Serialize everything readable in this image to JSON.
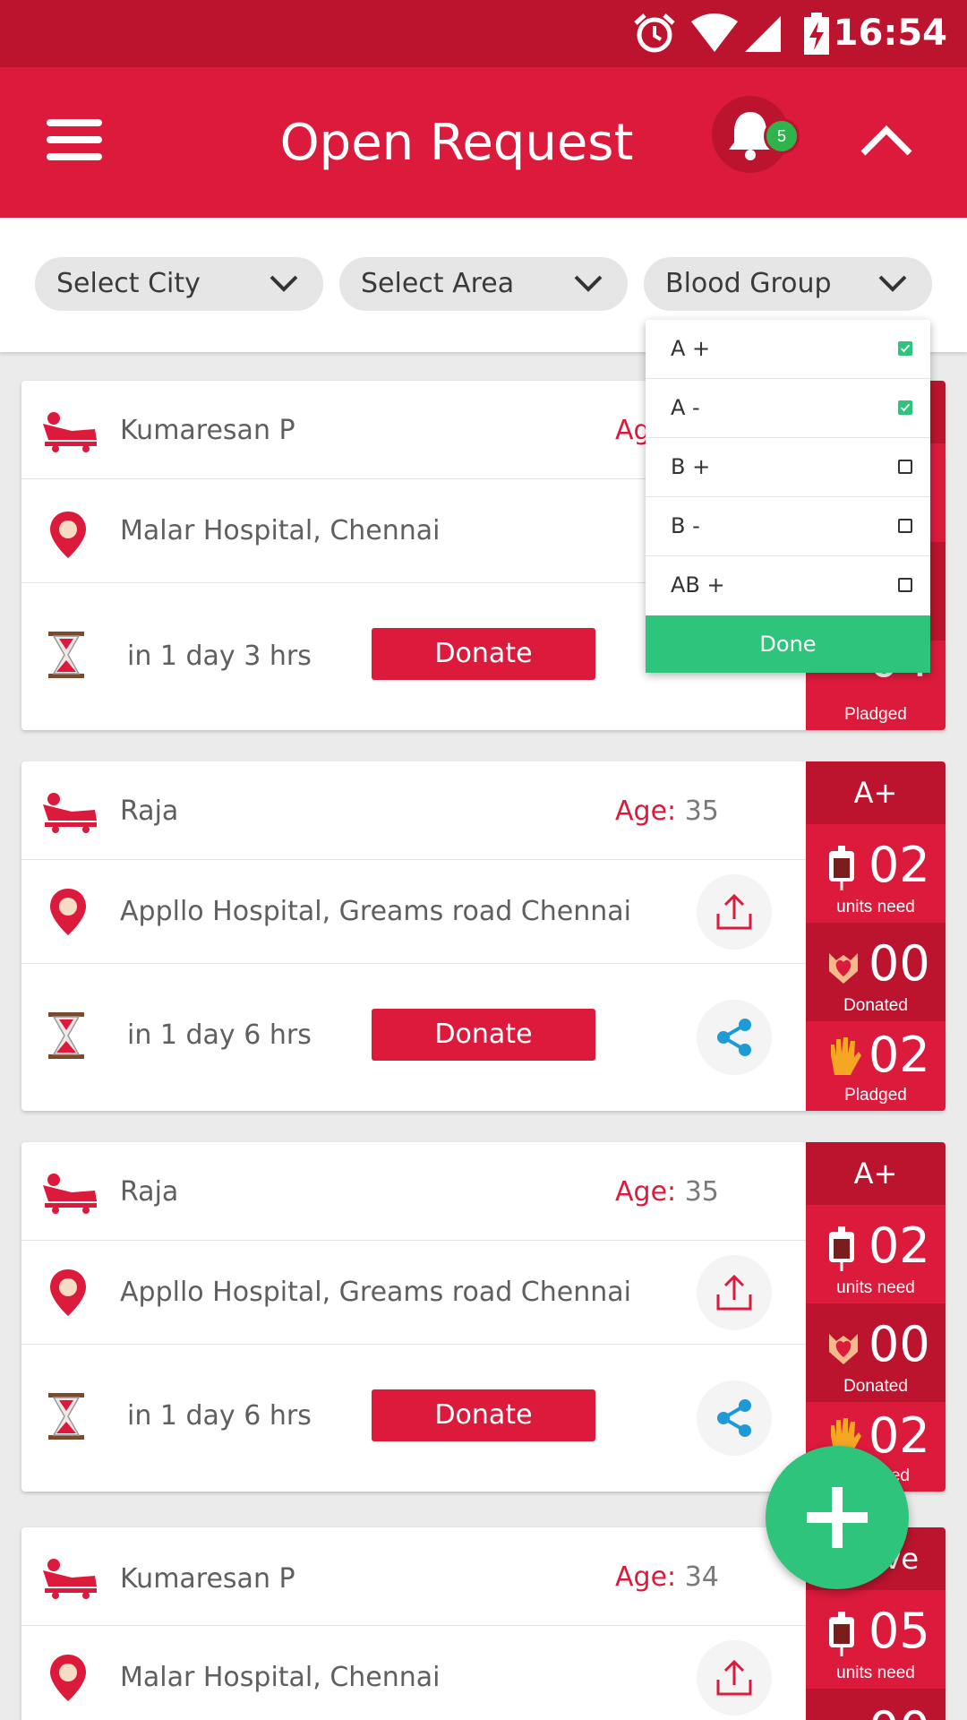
{
  "status_bar": {
    "time": "16:54"
  },
  "app_bar": {
    "title": "Open Request",
    "notification_count": "5"
  },
  "filters": {
    "city": "Select City",
    "area": "Select Area",
    "blood_group": "Blood Group"
  },
  "blood_group_dropdown": {
    "options": [
      {
        "label": "A +",
        "checked": true
      },
      {
        "label": "A -",
        "checked": true
      },
      {
        "label": "B +",
        "checked": false
      },
      {
        "label": "B -",
        "checked": false
      },
      {
        "label": "AB +",
        "checked": false
      }
    ],
    "done_label": "Done"
  },
  "labels": {
    "age": "Age:",
    "donate": "Donate",
    "units_need": "units need",
    "donated": "Donated",
    "pledged": "Pladged"
  },
  "requests": [
    {
      "name": "Kumaresan P",
      "age_partial": "Ag",
      "hospital": "Malar Hospital, Chennai",
      "time_left": "in 1 day 3 hrs",
      "pledged": "04"
    },
    {
      "name": "Raja",
      "age": "35",
      "hospital": "Appllo Hospital, Greams road Chennai",
      "time_left": "in 1 day 6 hrs",
      "blood_group": "A+",
      "units_need": "02",
      "donated": "00",
      "pledged": "02"
    },
    {
      "name": "Raja",
      "age": "35",
      "hospital": "Appllo Hospital, Greams road Chennai",
      "time_left": "in 1 day 6 hrs",
      "blood_group": "A+",
      "units_need": "02",
      "donated": "00",
      "pledged": "02",
      "pledged_caption_partial": "ed"
    },
    {
      "name": "Kumaresan P",
      "age": "34",
      "hospital": "Malar Hospital, Chennai",
      "blood_group_partial": "ve",
      "units_need": "05",
      "donated_partial": "00"
    }
  ],
  "colors": {
    "primary": "#dc1a3c",
    "primary_dark": "#bc142f",
    "accent": "#2ec47c",
    "share": "#1e9ad6"
  }
}
